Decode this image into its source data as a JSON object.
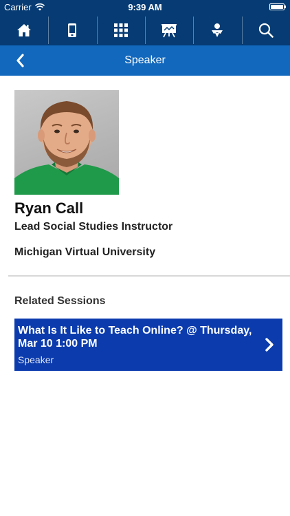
{
  "status": {
    "carrier": "Carrier",
    "time": "9:39 AM",
    "battery_level": 1.0
  },
  "nav": {
    "icons": [
      "home-icon",
      "device-icon",
      "grid-icon",
      "presentation-icon",
      "sponsor-icon",
      "search-icon"
    ]
  },
  "header": {
    "title": "Speaker",
    "back_icon": "chevron-left-icon"
  },
  "speaker": {
    "name": "Ryan Call",
    "title": "Lead Social Studies Instructor",
    "organization": "Michigan Virtual University"
  },
  "related": {
    "heading": "Related Sessions",
    "sessions": [
      {
        "title": "What Is It Like to Teach Online? @ Thursday, Mar 10 1:00 PM",
        "role": "Speaker"
      }
    ]
  },
  "colors": {
    "topbar": "#063b73",
    "titlebar": "#1268bd",
    "session_card": "#0b3bad"
  }
}
